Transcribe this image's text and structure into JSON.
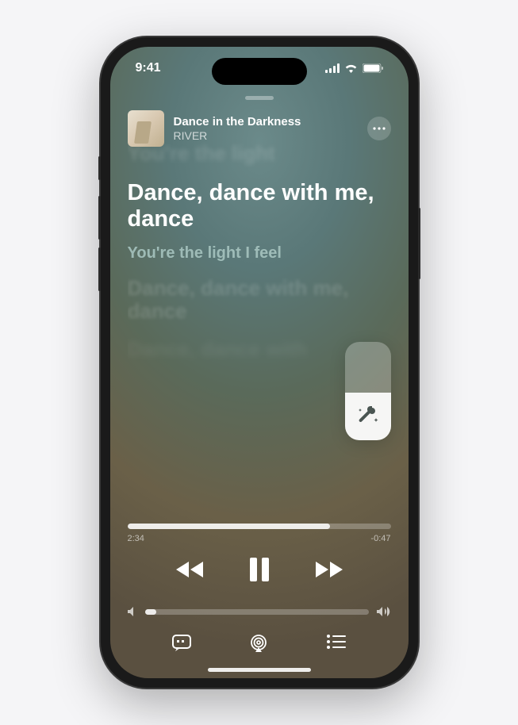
{
  "status": {
    "time": "9:41"
  },
  "track": {
    "title": "Dance in the Darkness",
    "artist": "RIVER"
  },
  "lyrics": {
    "prev_faded": "You're the light",
    "current": "Dance, dance with me, dance",
    "next": "You're the light I feel",
    "future": "Dance, dance with me, dance",
    "future2": "Dance, dance with"
  },
  "player": {
    "elapsed": "2:34",
    "remaining": "-0:47",
    "progress_percent": 77,
    "sing_level_percent": 48,
    "volume_percent": 5
  }
}
